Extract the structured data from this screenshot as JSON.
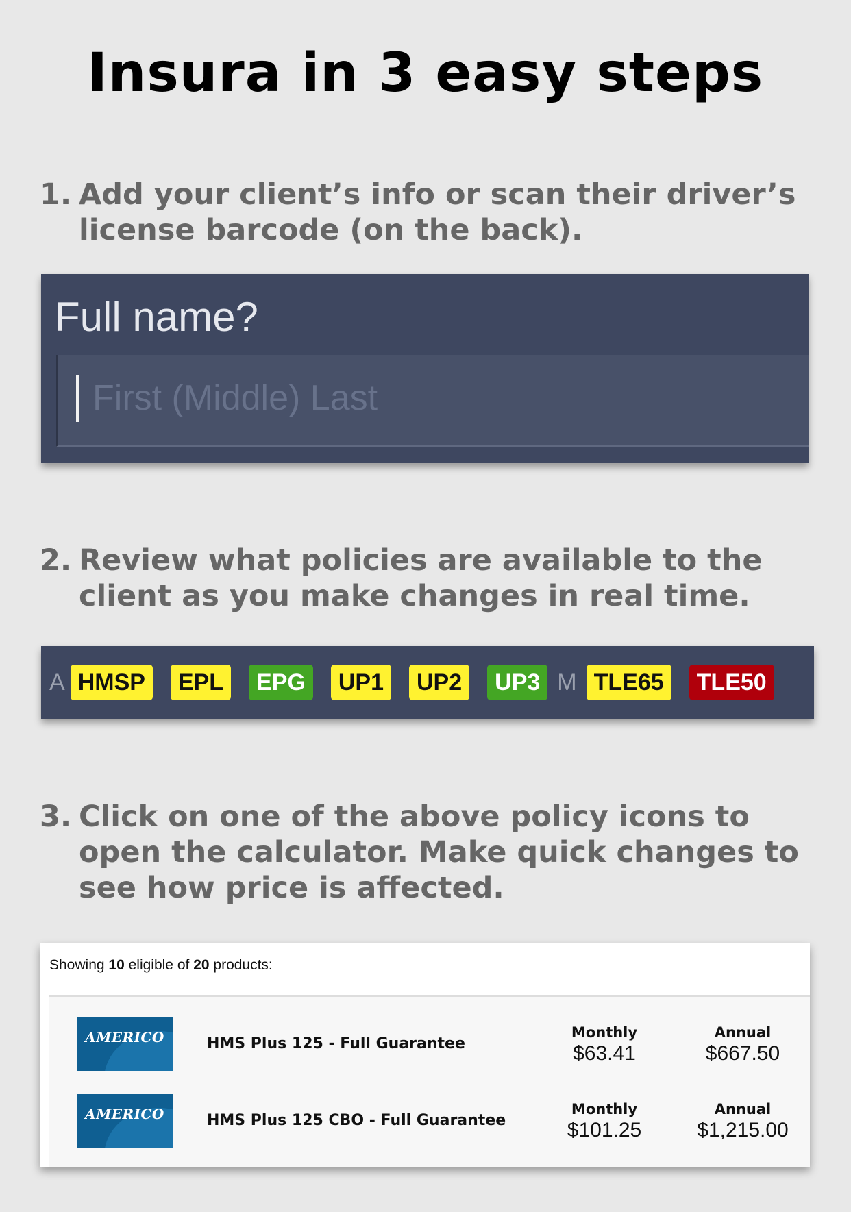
{
  "title": "Insura in 3 easy steps",
  "steps": [
    {
      "number": "1.",
      "text": "Add your client’s info or scan their driver’s license barcode (on the back)."
    },
    {
      "number": "2.",
      "text": "Review what policies are available to the client as you make changes in real time."
    },
    {
      "number": "3.",
      "text": "Click on one of the above policy icons to open the calculator. Make quick changes to see how price is affected."
    }
  ],
  "name_form": {
    "question": "Full name?",
    "placeholder": "First (Middle) Last"
  },
  "policy_bar": {
    "group_a_label": "A",
    "group_m_label": "M",
    "tags": [
      {
        "label": "HMSP",
        "color": "yellow"
      },
      {
        "label": "EPL",
        "color": "yellow"
      },
      {
        "label": "EPG",
        "color": "green"
      },
      {
        "label": "UP1",
        "color": "yellow"
      },
      {
        "label": "UP2",
        "color": "yellow"
      },
      {
        "label": "UP3",
        "color": "green"
      },
      {
        "label": "TLE65",
        "color": "yellow"
      },
      {
        "label": "TLE50",
        "color": "red"
      }
    ],
    "colors": {
      "yellow": "#fff230",
      "green": "#44a624",
      "red": "#b0000b",
      "panel": "#3e4760"
    }
  },
  "products": {
    "showing_prefix": "Showing",
    "eligible_count": "10",
    "eligible_mid": "eligible of",
    "total_count": "20",
    "showing_suffix": "products:",
    "items": [
      {
        "logo_text": "AMERICO",
        "name": "HMS Plus 125 - Full Guarantee",
        "monthly_label": "Monthly",
        "monthly": "$63.41",
        "annual_label": "Annual",
        "annual": "$667.50"
      },
      {
        "logo_text": "AMERICO",
        "name": "HMS Plus 125 CBO - Full Guarantee",
        "monthly_label": "Monthly",
        "monthly": "$101.25",
        "annual_label": "Annual",
        "annual": "$1,215.00"
      }
    ]
  }
}
